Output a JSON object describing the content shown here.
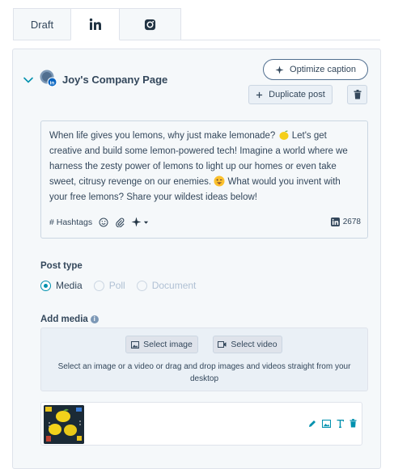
{
  "tabs": [
    {
      "label": "Draft",
      "active": false
    },
    {
      "label": "",
      "icon": "linkedin-icon",
      "active": true
    },
    {
      "label": "",
      "icon": "instagram-icon",
      "active": false
    }
  ],
  "account": {
    "name": "Joy's Company Page"
  },
  "actions": {
    "optimize_label": "Optimize caption",
    "duplicate_label": "Duplicate post"
  },
  "caption": {
    "text_1": "When life gives you lemons, why just make lemonade?",
    "text_2": "Let's get creative and build some lemon-powered tech! Imagine a world where we harness the zesty power of lemons to light up our homes or even take sweet, citrusy revenge on our enemies.",
    "text_3": "What would you invent with your free lemons? Share your wildest ideas below!"
  },
  "toolbar": {
    "hashtags_label": "# Hashtags",
    "char_count": "2678"
  },
  "post_type": {
    "heading": "Post type",
    "options": [
      {
        "label": "Media",
        "selected": true
      },
      {
        "label": "Poll",
        "selected": false
      },
      {
        "label": "Document",
        "selected": false
      }
    ]
  },
  "media": {
    "heading": "Add media",
    "select_image_label": "Select image",
    "select_video_label": "Select video",
    "hint": "Select an image or a video or drag and drop images and videos straight from your desktop"
  },
  "colors": {
    "accent": "#0091ae",
    "text": "#33475b",
    "panel_bg": "#f5f8fa",
    "linkedin": "#0a66c2"
  }
}
